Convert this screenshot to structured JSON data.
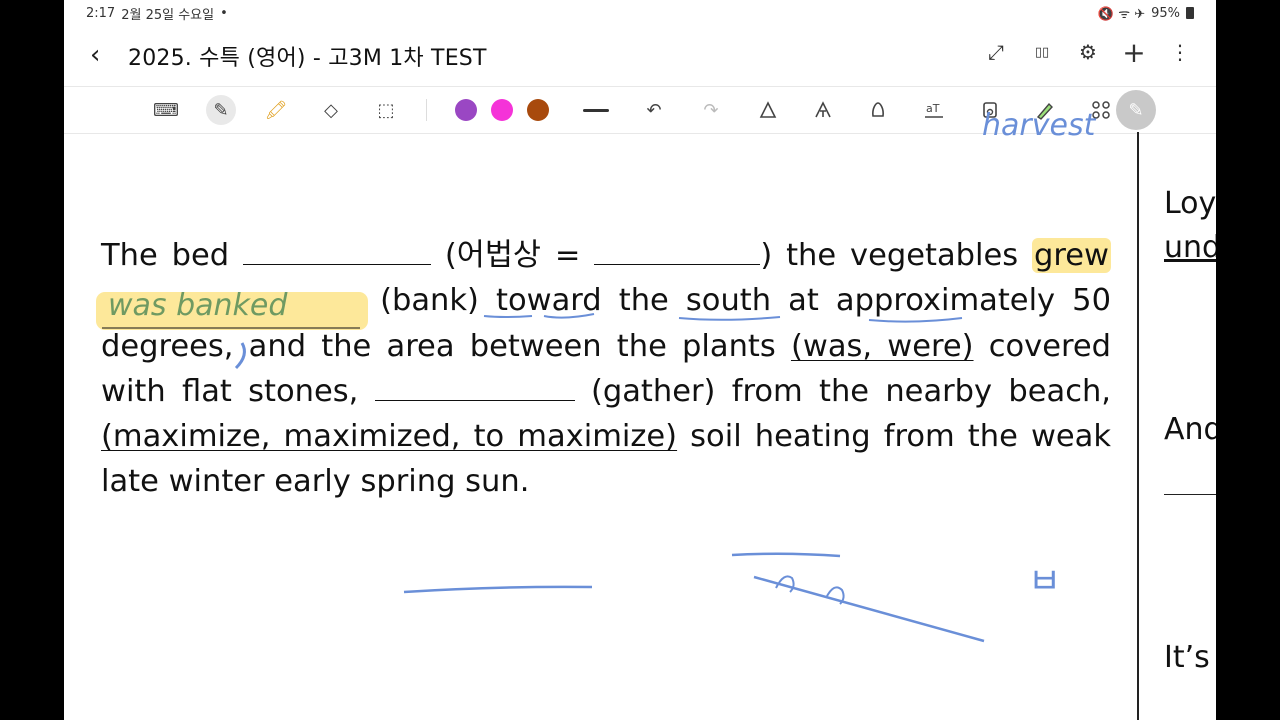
{
  "status_bar": {
    "time": "2:17",
    "date": "2월 25일 수요일",
    "dot": "•",
    "signal": "🔇 ᯤ ✈",
    "battery_text": "95%"
  },
  "header": {
    "title": "2025. 수특 (영어) - 고3M 1차 TEST",
    "back_glyph": "‹",
    "expand_glyph": "⤢",
    "book_glyph": "▯▯",
    "settings_glyph": "⚙",
    "add_glyph": "+",
    "more_glyph": "⋮"
  },
  "toolbar": {
    "keyboard_glyph": "⌨",
    "pen_glyph": "✎",
    "highlighter_glyph": "🖍",
    "eraser_glyph": "◇",
    "lasso_glyph": "⬚",
    "colors": [
      "#9a47c3",
      "#f533d8",
      "#a84a0d"
    ],
    "undo_glyph": "↶",
    "redo_glyph": "↷",
    "fab_glyph": "✎"
  },
  "document": {
    "p1": "The bed",
    "p2": "(어법상 =",
    "p3": ") the vegetables",
    "grew": "grew",
    "bank": "(bank)",
    "toward": "toward",
    "the1": "the",
    "south": "south",
    "at": "at",
    "approx": "approximately 50",
    "degrees": "degrees, and the area between the plants",
    "waswere": "(was, were)",
    "covered": "covered",
    "with": "with flat stones,",
    "gather": "(gather) from the nearby beach,",
    "options": "(maximize, maximized, to maximize)",
    "soil": "soil heating from the",
    "last": "weak late winter early spring sun.",
    "handwritten_answer": "was banked",
    "top_scribble": "harvest",
    "note_right": "ㅂ"
  },
  "side_page": {
    "line1": "Loy",
    "line2": "und",
    "line3": "And",
    "line4": "It’s"
  }
}
